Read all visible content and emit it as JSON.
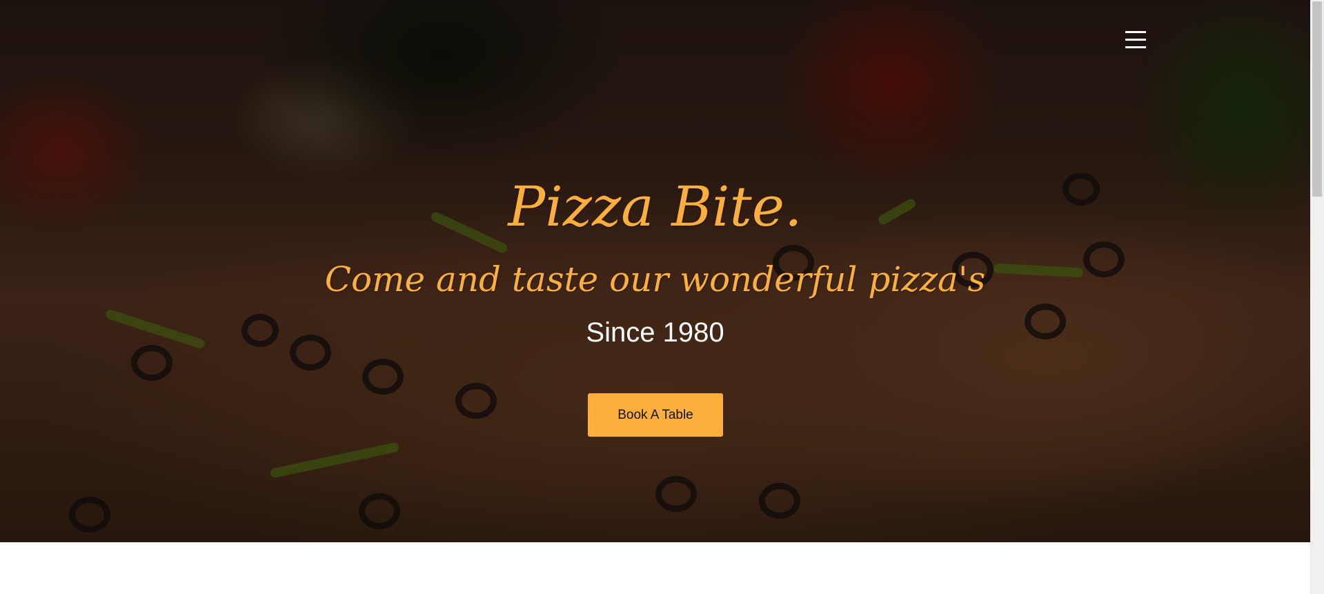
{
  "hero": {
    "title": "Pizza Bite.",
    "subtitle": "Come and taste our wonderful pizza's",
    "since": "Since 1980",
    "book_button_label": "Book A Table",
    "background_image": "pizza-photo"
  },
  "nav": {
    "menu_icon": "hamburger-menu-icon"
  },
  "colors": {
    "accent": "#fdaf3d",
    "text_light": "#ffffff",
    "button_text": "#111111"
  }
}
